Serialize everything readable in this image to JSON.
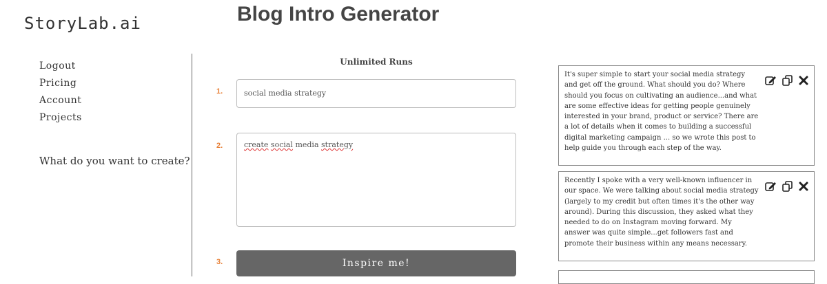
{
  "brand": {
    "logo": "StoryLab.ai"
  },
  "page": {
    "title": "Blog Intro Generator"
  },
  "sidebar": {
    "items": [
      {
        "label": "Logout"
      },
      {
        "label": "Pricing"
      },
      {
        "label": "Account"
      },
      {
        "label": "Projects"
      }
    ],
    "prompt": "What do you want to create?"
  },
  "form": {
    "runs_label": "Unlimited Runs",
    "step1": {
      "number": "1.",
      "value": "social media strategy"
    },
    "step2": {
      "number": "2.",
      "value_words": [
        "create",
        "social",
        "media",
        "strategy"
      ]
    },
    "step3": {
      "number": "3.",
      "button_label": "Inspire me!"
    }
  },
  "results": [
    {
      "text": "It's super simple to start your social media strategy and get off the ground. What should you do? Where should you focus on cultivating an audience...and what are some effective ideas for getting people genuinely interested in your brand, product or service?  There are a lot of details when it comes to building a successful digital marketing campaign ... so we wrote this post to help guide you through each step of the way."
    },
    {
      "text": "Recently I spoke with a very well-known influencer in our space. We were talking about social media strategy (largely to my credit but often times it's the other way around). During this discussion, they asked what they needed to do on Instagram moving forward.   My answer was quite simple...get followers fast and promote their business within any means necessary."
    }
  ],
  "icons": {
    "edit": "edit-icon",
    "copy": "copy-icon",
    "close": "close-icon"
  },
  "colors": {
    "accent": "#e8823a",
    "button": "#666666"
  }
}
